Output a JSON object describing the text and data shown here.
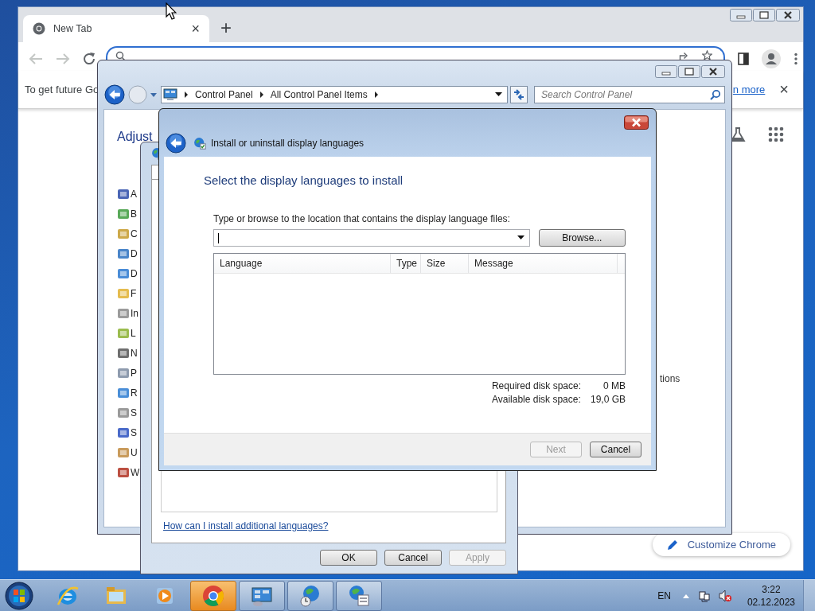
{
  "chrome": {
    "tab": {
      "title": "New Tab",
      "close": "×"
    },
    "new_tab": "+",
    "infobar": {
      "text": "To get future Go",
      "link": "n more",
      "close": "×"
    },
    "customize": "Customize Chrome"
  },
  "control_panel": {
    "breadcrumb": [
      "Control Panel",
      "All Control Panel Items"
    ],
    "search": {
      "placeholder": "Search Control Panel"
    },
    "heading": "Adjust",
    "items": [
      {
        "label": "A"
      },
      {
        "label": "B"
      },
      {
        "label": "C"
      },
      {
        "label": "D"
      },
      {
        "label": "D"
      },
      {
        "label": "F"
      },
      {
        "label": "In"
      },
      {
        "label": "L"
      },
      {
        "label": "N"
      },
      {
        "label": "P"
      },
      {
        "label": "R"
      },
      {
        "label": "S"
      },
      {
        "label": "S"
      },
      {
        "label": "U"
      },
      {
        "label": "W"
      }
    ],
    "side_text": "tions"
  },
  "region_dialog": {
    "link": "How can I install additional languages?",
    "buttons": [
      {
        "label": "OK",
        "disabled": false
      },
      {
        "label": "Cancel",
        "disabled": false
      },
      {
        "label": "Apply",
        "disabled": true
      }
    ]
  },
  "install_dialog": {
    "title": "Install or uninstall display languages",
    "heading": "Select the display languages to install",
    "prompt": "Type or browse to the location that contains the display language files:",
    "browse": "Browse...",
    "columns": [
      "Language",
      "Type",
      "Size",
      "Message"
    ],
    "disk_space": [
      {
        "label": "Required disk space:",
        "value": "0 MB"
      },
      {
        "label": "Available disk space:",
        "value": "19,0 GB"
      }
    ],
    "buttons": [
      {
        "label": "Next",
        "disabled": true
      },
      {
        "label": "Cancel",
        "disabled": false
      }
    ]
  },
  "taskbar": {
    "language": "EN",
    "time": "3:22",
    "date": "02.12.2023"
  }
}
